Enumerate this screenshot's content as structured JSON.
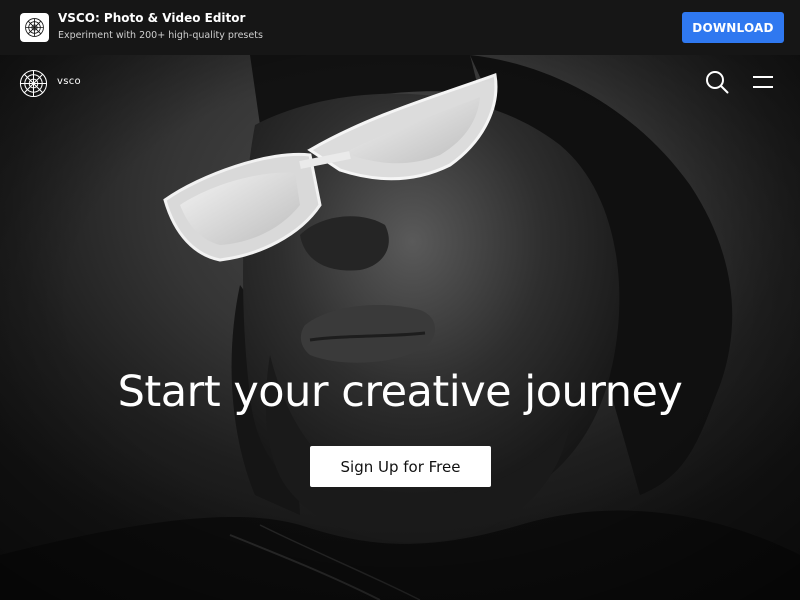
{
  "app_banner": {
    "title": "VSCO: Photo & Video Editor",
    "subtitle": "Experiment with 200+ high-quality presets",
    "download_label": "DOWNLOAD",
    "download_color": "#2f78f0",
    "app_icon": "vsco-logo-icon"
  },
  "nav": {
    "brand": "vsco",
    "logo_icon": "vsco-logo-icon",
    "search_icon": "search-icon",
    "menu_icon": "hamburger-menu-icon"
  },
  "hero": {
    "headline": "Start your creative journey",
    "cta_label": "Sign Up for Free",
    "image": "black-and-white portrait of a man wearing white sunglasses"
  }
}
